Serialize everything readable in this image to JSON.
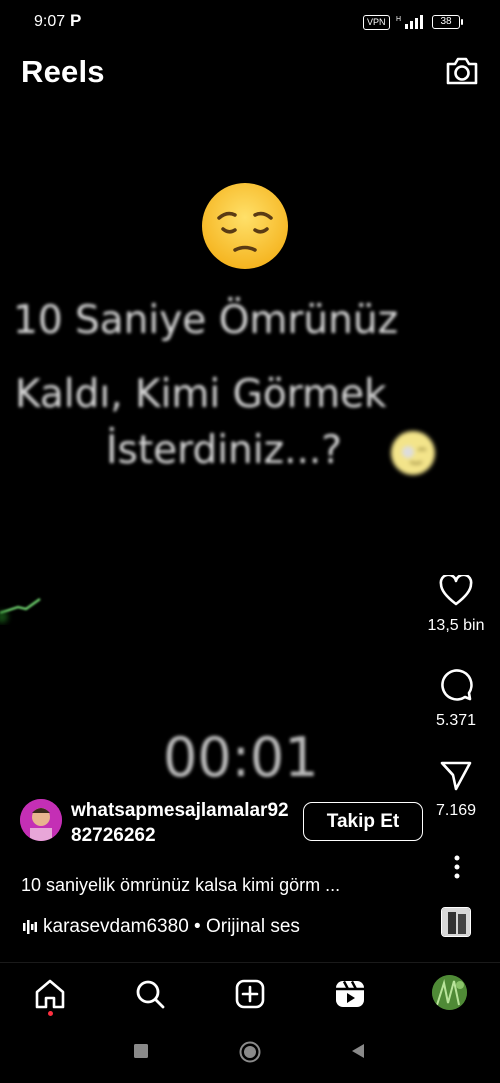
{
  "status": {
    "time": "9:07",
    "carrier_icon": "P",
    "vpn": "VPN",
    "network": "H",
    "battery": "38"
  },
  "header": {
    "title": "Reels",
    "camera_icon": "camera-icon"
  },
  "video": {
    "overlay_lines": [
      "10 Saniye Ömrünüz",
      "Kaldı, Kimi Görmek",
      "İsterdiniz...?"
    ],
    "timer": "00:01",
    "emoji_top": "pensive-face",
    "emoji_inline": "winking-face"
  },
  "actions": {
    "likes": "13,5 bin",
    "comments": "5.371",
    "shares": "7.169"
  },
  "post": {
    "username": "whatsapmesajlamalar9282726262",
    "follow_label": "Takip Et",
    "caption": "10 saniyelik ömrünüz kalsa kimi görm ...",
    "audio": "karasevdam6380 • Orijinal ses"
  },
  "nav": {
    "items": [
      "home-icon",
      "search-icon",
      "create-icon",
      "reels-icon",
      "profile-avatar"
    ]
  },
  "colors": {
    "background": "#000000",
    "text": "#ffffff",
    "notification_dot": "#ff3040"
  }
}
